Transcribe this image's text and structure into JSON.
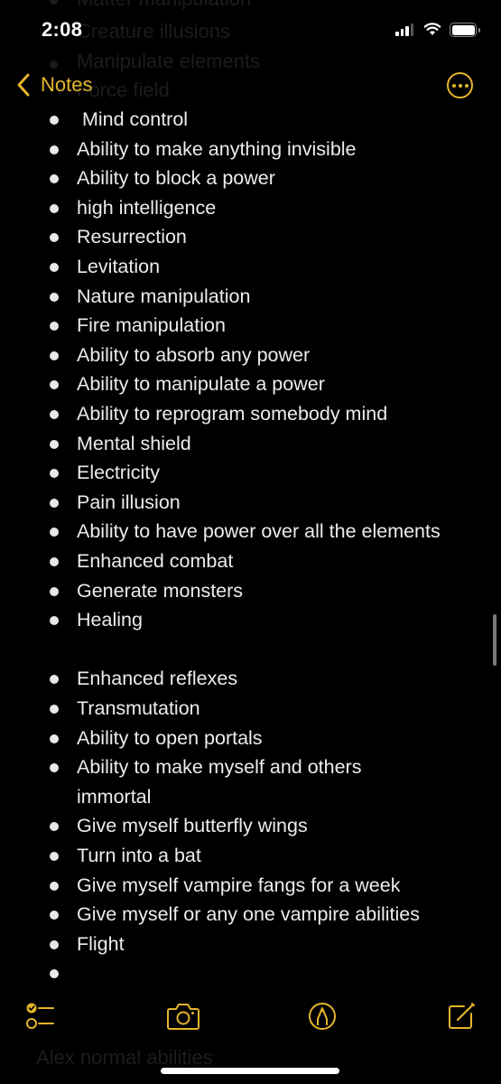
{
  "status_bar": {
    "time": "2:08",
    "signal_bars": 3,
    "signal_bars_total": 4,
    "wifi": "wifi-icon",
    "battery_level": "full"
  },
  "nav": {
    "back_label": "Notes",
    "back_icon": "chevron-left-icon",
    "more_icon": "ellipsis-circle-icon"
  },
  "accent_color": "#e5b52b",
  "ghost_text_above": [
    "Matter manipulation",
    "Creature illusions",
    "Manipulate elements",
    "Force field"
  ],
  "note_items": [
    " Mind control",
    "Ability to make anything invisible",
    "Ability to block a power",
    "high intelligence",
    "Resurrection",
    "Levitation",
    "Nature manipulation",
    "Fire manipulation",
    "Ability to absorb any power",
    "Ability to manipulate a power",
    "Ability to reprogram somebody mind",
    "Mental shield",
    "Electricity",
    "Pain illusion",
    "Ability to have power over all the elements",
    "Enhanced combat",
    "Generate monsters",
    "Healing",
    "Enhanced reflexes",
    "Transmutation",
    "Ability to open portals",
    "Ability to make myself and others immortal",
    "Give myself butterfly wings",
    "Turn into a bat",
    "Give myself vampire fangs for a week",
    "Give myself or any one vampire abilities",
    "Flight",
    ""
  ],
  "ghost_text_below": "Alex normal abilities",
  "toolbar": {
    "checklist_icon": "checklist-icon",
    "camera_icon": "camera-icon",
    "markup_icon": "markup-pen-icon",
    "compose_icon": "compose-icon"
  }
}
